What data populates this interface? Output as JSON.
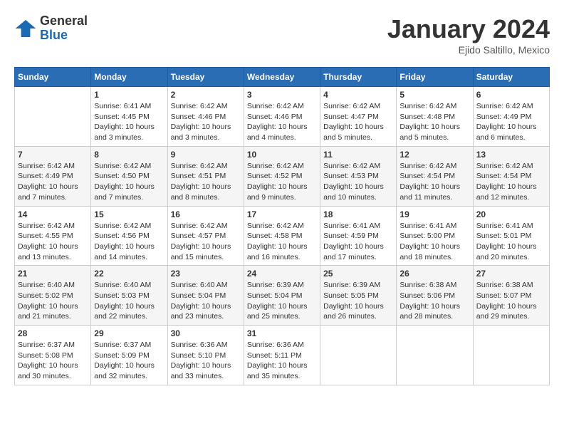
{
  "header": {
    "logo_general": "General",
    "logo_blue": "Blue",
    "month_title": "January 2024",
    "subtitle": "Ejido Saltillo, Mexico"
  },
  "weekdays": [
    "Sunday",
    "Monday",
    "Tuesday",
    "Wednesday",
    "Thursday",
    "Friday",
    "Saturday"
  ],
  "weeks": [
    [
      {
        "day": "",
        "sunrise": "",
        "sunset": "",
        "daylight": ""
      },
      {
        "day": "1",
        "sunrise": "Sunrise: 6:41 AM",
        "sunset": "Sunset: 4:45 PM",
        "daylight": "Daylight: 10 hours and 3 minutes."
      },
      {
        "day": "2",
        "sunrise": "Sunrise: 6:42 AM",
        "sunset": "Sunset: 4:46 PM",
        "daylight": "Daylight: 10 hours and 3 minutes."
      },
      {
        "day": "3",
        "sunrise": "Sunrise: 6:42 AM",
        "sunset": "Sunset: 4:46 PM",
        "daylight": "Daylight: 10 hours and 4 minutes."
      },
      {
        "day": "4",
        "sunrise": "Sunrise: 6:42 AM",
        "sunset": "Sunset: 4:47 PM",
        "daylight": "Daylight: 10 hours and 5 minutes."
      },
      {
        "day": "5",
        "sunrise": "Sunrise: 6:42 AM",
        "sunset": "Sunset: 4:48 PM",
        "daylight": "Daylight: 10 hours and 5 minutes."
      },
      {
        "day": "6",
        "sunrise": "Sunrise: 6:42 AM",
        "sunset": "Sunset: 4:49 PM",
        "daylight": "Daylight: 10 hours and 6 minutes."
      }
    ],
    [
      {
        "day": "7",
        "sunrise": "Sunrise: 6:42 AM",
        "sunset": "Sunset: 4:49 PM",
        "daylight": "Daylight: 10 hours and 7 minutes."
      },
      {
        "day": "8",
        "sunrise": "Sunrise: 6:42 AM",
        "sunset": "Sunset: 4:50 PM",
        "daylight": "Daylight: 10 hours and 7 minutes."
      },
      {
        "day": "9",
        "sunrise": "Sunrise: 6:42 AM",
        "sunset": "Sunset: 4:51 PM",
        "daylight": "Daylight: 10 hours and 8 minutes."
      },
      {
        "day": "10",
        "sunrise": "Sunrise: 6:42 AM",
        "sunset": "Sunset: 4:52 PM",
        "daylight": "Daylight: 10 hours and 9 minutes."
      },
      {
        "day": "11",
        "sunrise": "Sunrise: 6:42 AM",
        "sunset": "Sunset: 4:53 PM",
        "daylight": "Daylight: 10 hours and 10 minutes."
      },
      {
        "day": "12",
        "sunrise": "Sunrise: 6:42 AM",
        "sunset": "Sunset: 4:54 PM",
        "daylight": "Daylight: 10 hours and 11 minutes."
      },
      {
        "day": "13",
        "sunrise": "Sunrise: 6:42 AM",
        "sunset": "Sunset: 4:54 PM",
        "daylight": "Daylight: 10 hours and 12 minutes."
      }
    ],
    [
      {
        "day": "14",
        "sunrise": "Sunrise: 6:42 AM",
        "sunset": "Sunset: 4:55 PM",
        "daylight": "Daylight: 10 hours and 13 minutes."
      },
      {
        "day": "15",
        "sunrise": "Sunrise: 6:42 AM",
        "sunset": "Sunset: 4:56 PM",
        "daylight": "Daylight: 10 hours and 14 minutes."
      },
      {
        "day": "16",
        "sunrise": "Sunrise: 6:42 AM",
        "sunset": "Sunset: 4:57 PM",
        "daylight": "Daylight: 10 hours and 15 minutes."
      },
      {
        "day": "17",
        "sunrise": "Sunrise: 6:42 AM",
        "sunset": "Sunset: 4:58 PM",
        "daylight": "Daylight: 10 hours and 16 minutes."
      },
      {
        "day": "18",
        "sunrise": "Sunrise: 6:41 AM",
        "sunset": "Sunset: 4:59 PM",
        "daylight": "Daylight: 10 hours and 17 minutes."
      },
      {
        "day": "19",
        "sunrise": "Sunrise: 6:41 AM",
        "sunset": "Sunset: 5:00 PM",
        "daylight": "Daylight: 10 hours and 18 minutes."
      },
      {
        "day": "20",
        "sunrise": "Sunrise: 6:41 AM",
        "sunset": "Sunset: 5:01 PM",
        "daylight": "Daylight: 10 hours and 20 minutes."
      }
    ],
    [
      {
        "day": "21",
        "sunrise": "Sunrise: 6:40 AM",
        "sunset": "Sunset: 5:02 PM",
        "daylight": "Daylight: 10 hours and 21 minutes."
      },
      {
        "day": "22",
        "sunrise": "Sunrise: 6:40 AM",
        "sunset": "Sunset: 5:03 PM",
        "daylight": "Daylight: 10 hours and 22 minutes."
      },
      {
        "day": "23",
        "sunrise": "Sunrise: 6:40 AM",
        "sunset": "Sunset: 5:04 PM",
        "daylight": "Daylight: 10 hours and 23 minutes."
      },
      {
        "day": "24",
        "sunrise": "Sunrise: 6:39 AM",
        "sunset": "Sunset: 5:04 PM",
        "daylight": "Daylight: 10 hours and 25 minutes."
      },
      {
        "day": "25",
        "sunrise": "Sunrise: 6:39 AM",
        "sunset": "Sunset: 5:05 PM",
        "daylight": "Daylight: 10 hours and 26 minutes."
      },
      {
        "day": "26",
        "sunrise": "Sunrise: 6:38 AM",
        "sunset": "Sunset: 5:06 PM",
        "daylight": "Daylight: 10 hours and 28 minutes."
      },
      {
        "day": "27",
        "sunrise": "Sunrise: 6:38 AM",
        "sunset": "Sunset: 5:07 PM",
        "daylight": "Daylight: 10 hours and 29 minutes."
      }
    ],
    [
      {
        "day": "28",
        "sunrise": "Sunrise: 6:37 AM",
        "sunset": "Sunset: 5:08 PM",
        "daylight": "Daylight: 10 hours and 30 minutes."
      },
      {
        "day": "29",
        "sunrise": "Sunrise: 6:37 AM",
        "sunset": "Sunset: 5:09 PM",
        "daylight": "Daylight: 10 hours and 32 minutes."
      },
      {
        "day": "30",
        "sunrise": "Sunrise: 6:36 AM",
        "sunset": "Sunset: 5:10 PM",
        "daylight": "Daylight: 10 hours and 33 minutes."
      },
      {
        "day": "31",
        "sunrise": "Sunrise: 6:36 AM",
        "sunset": "Sunset: 5:11 PM",
        "daylight": "Daylight: 10 hours and 35 minutes."
      },
      {
        "day": "",
        "sunrise": "",
        "sunset": "",
        "daylight": ""
      },
      {
        "day": "",
        "sunrise": "",
        "sunset": "",
        "daylight": ""
      },
      {
        "day": "",
        "sunrise": "",
        "sunset": "",
        "daylight": ""
      }
    ]
  ]
}
